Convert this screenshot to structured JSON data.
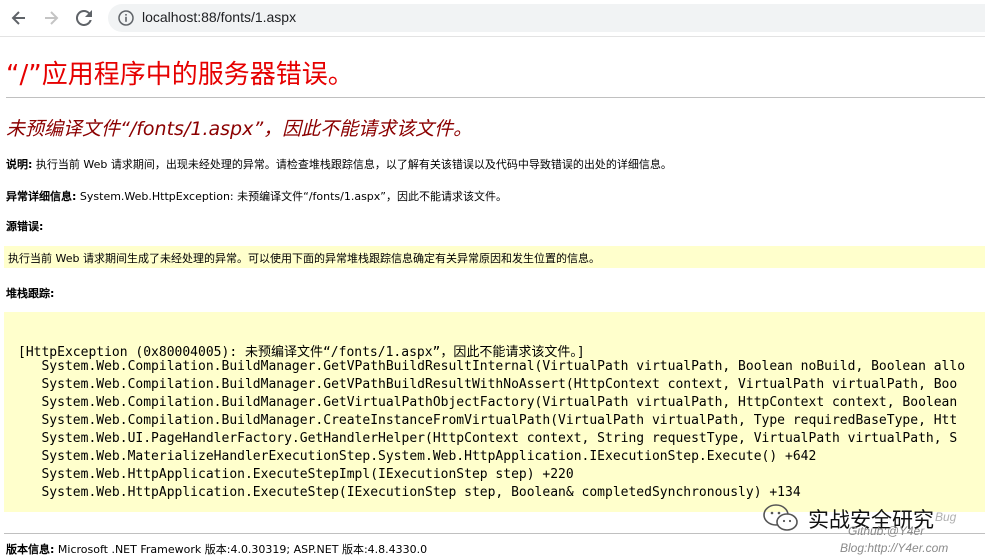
{
  "browser": {
    "url": "localhost:88/fonts/1.aspx",
    "back_icon": "back-arrow-icon",
    "forward_icon": "forward-arrow-icon",
    "reload_icon": "reload-icon",
    "info_icon": "info-icon"
  },
  "page": {
    "title": "“/”应用程序中的服务器错误。",
    "subtitle": "未预编译文件“/fonts/1.aspx”，因此不能请求该文件。",
    "description_label": "说明:",
    "description_text": " 执行当前 Web 请求期间，出现未经处理的异常。请检查堆栈跟踪信息，以了解有关该错误以及代码中导致错误的出处的详细信息。",
    "exception_label": "异常详细信息:",
    "exception_text": " System.Web.HttpException: 未预编译文件“/fonts/1.aspx”，因此不能请求该文件。",
    "source_label": "源错误:",
    "source_text": "执行当前 Web 请求期间生成了未经处理的异常。可以使用下面的异常堆栈跟踪信息确定有关异常原因和发生位置的信息。",
    "stack_label": "堆栈跟踪:",
    "stack_lines": [
      "[HttpException (0x80004005): 未预编译文件“/fonts/1.aspx”，因此不能请求该文件。]",
      "   System.Web.Compilation.BuildManager.GetVPathBuildResultInternal(VirtualPath virtualPath, Boolean noBuild, Boolean allo",
      "   System.Web.Compilation.BuildManager.GetVPathBuildResultWithNoAssert(HttpContext context, VirtualPath virtualPath, Boo",
      "   System.Web.Compilation.BuildManager.GetVirtualPathObjectFactory(VirtualPath virtualPath, HttpContext context, Boolean",
      "   System.Web.Compilation.BuildManager.CreateInstanceFromVirtualPath(VirtualPath virtualPath, Type requiredBaseType, Htt",
      "   System.Web.UI.PageHandlerFactory.GetHandlerHelper(HttpContext context, String requestType, VirtualPath virtualPath, S",
      "   System.Web.MaterializeHandlerExecutionStep.System.Web.HttpApplication.IExecutionStep.Execute() +642",
      "   System.Web.HttpApplication.ExecuteStepImpl(IExecutionStep step) +220",
      "   System.Web.HttpApplication.ExecuteStep(IExecutionStep step, Boolean& completedSynchronously) +134"
    ],
    "version_label": "版本信息:",
    "version_text": " Microsoft .NET Framework 版本:4.0.30319; ASP.NET 版本:4.8.4330.0"
  },
  "watermark": {
    "title": "实战安全研究",
    "bug": "Bug",
    "github": "Github:@Y4er",
    "blog": "Blog:http://Y4er.com"
  },
  "colors": {
    "title_red": "#e60000",
    "subtitle_darkred": "#8b0000",
    "code_bg": "#ffffcc"
  }
}
